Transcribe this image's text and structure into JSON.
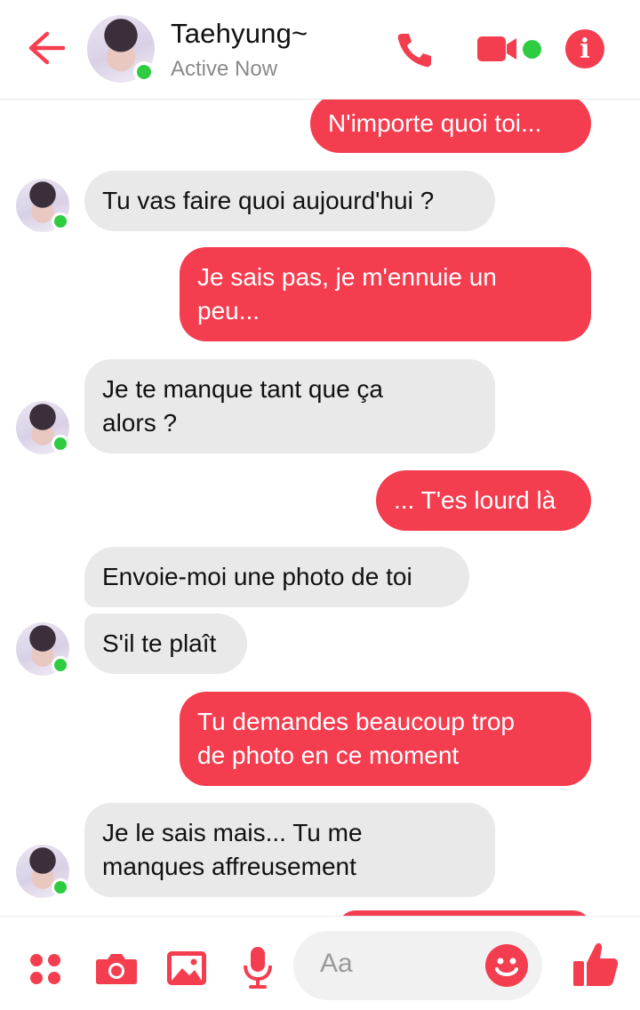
{
  "header": {
    "contact_name": "Taehyung~",
    "status": "Active Now"
  },
  "colors": {
    "accent": "#f43e50",
    "online": "#2ecc40",
    "incoming_bubble": "#e9e9e9"
  },
  "messages": [
    {
      "dir": "out",
      "lines": [
        "N'importe quoi toi..."
      ]
    },
    {
      "dir": "in",
      "lines": [
        "Tu vas faire quoi aujourd'hui ?"
      ]
    },
    {
      "dir": "out",
      "lines": [
        "Je sais pas, je m'ennuie un",
        "peu..."
      ]
    },
    {
      "dir": "in",
      "lines": [
        "Je te manque tant que ça",
        "alors ?"
      ]
    },
    {
      "dir": "out",
      "lines": [
        "... T'es lourd là"
      ]
    },
    {
      "dir": "in",
      "lines": [
        "Envoie-moi une photo de toi"
      ]
    },
    {
      "dir": "in",
      "lines": [
        "S'il te plaît"
      ]
    },
    {
      "dir": "out",
      "lines": [
        "Tu demandes beaucoup trop",
        "de photo en ce moment"
      ]
    },
    {
      "dir": "in",
      "lines": [
        "Je le sais mais... Tu me",
        "manques affreusement"
      ]
    }
  ],
  "composer": {
    "placeholder": "Aa"
  },
  "icons": [
    "back-arrow-icon",
    "phone-icon",
    "video-camera-icon",
    "info-icon",
    "apps-grid-icon",
    "camera-icon",
    "image-icon",
    "microphone-icon",
    "emoji-icon",
    "thumbs-up-icon"
  ]
}
